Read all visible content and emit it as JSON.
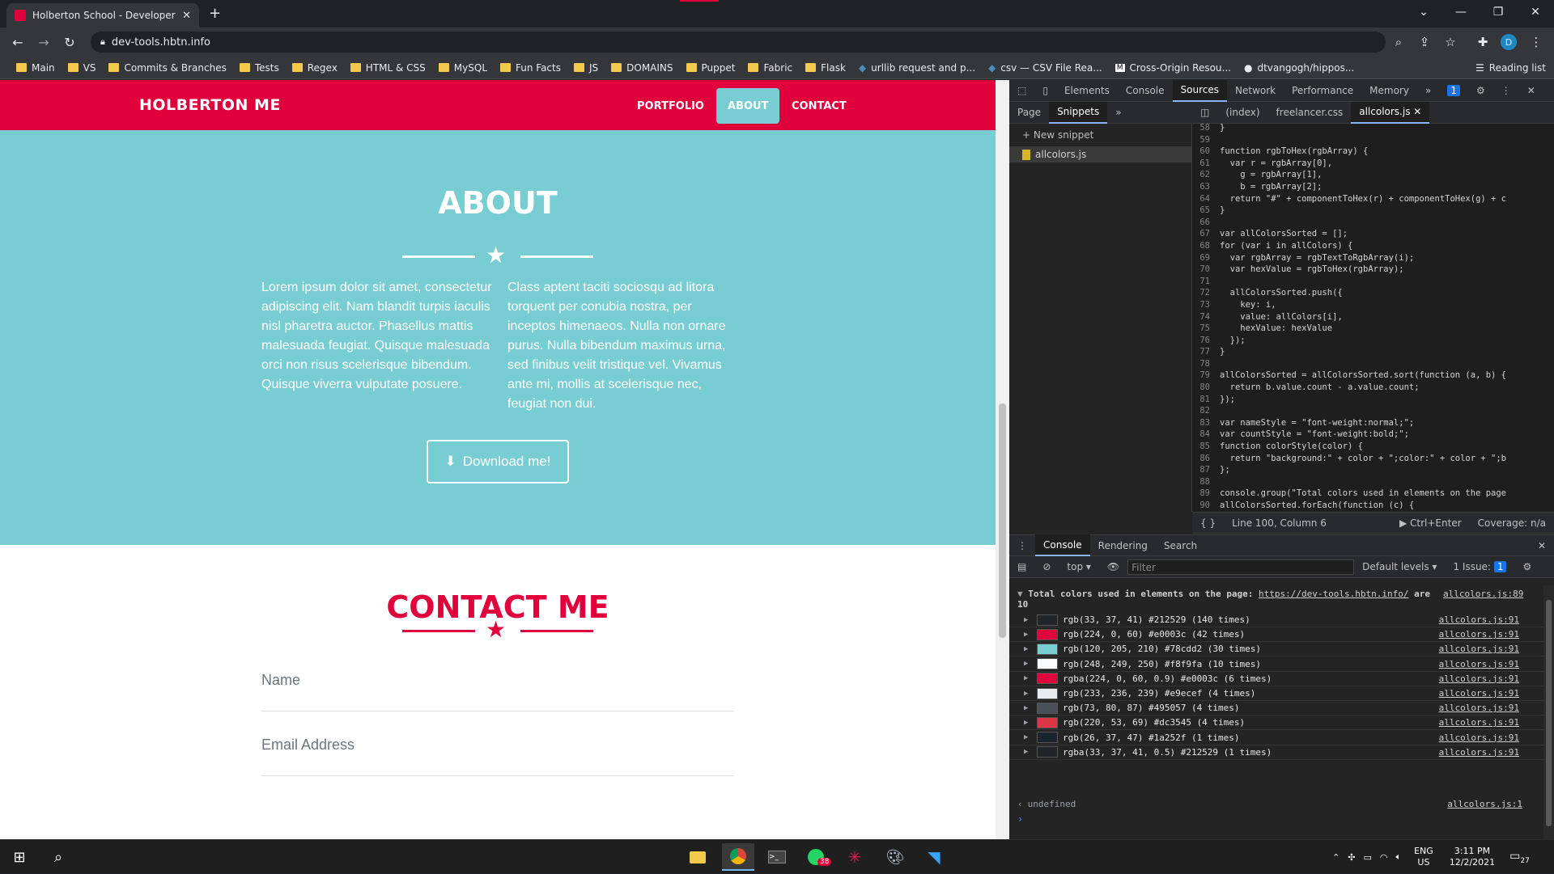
{
  "browser": {
    "tab_title": "Holberton School - Developer to",
    "url": "dev-tools.hbtn.info",
    "bookmarks": [
      "Main",
      "VS",
      "Commits & Branches",
      "Tests",
      "Regex",
      "HTML & CSS",
      "MySQL",
      "Fun Facts",
      "JS",
      "DOMAINS",
      "Puppet",
      "Fabric",
      "Flask",
      "urllib request and p...",
      "csv — CSV File Rea...",
      "Cross-Origin Resou...",
      "dtvangogh/hippos..."
    ],
    "reading_list": "Reading list",
    "profile_initial": "D"
  },
  "site": {
    "brand": "HOLBERTON ME",
    "nav": [
      "PORTFOLIO",
      "ABOUT",
      "CONTACT"
    ],
    "about_title": "ABOUT",
    "about_left": "Lorem ipsum dolor sit amet, consectetur adipiscing elit. Nam blandit turpis iaculis nisl pharetra auctor. Phasellus mattis malesuada feugiat. Quisque malesuada orci non risus scelerisque bibendum. Quisque viverra vulputate posuere.",
    "about_right": "Class aptent taciti sociosqu ad litora torquent per conubia nostra, per inceptos himenaeos. Nulla non ornare purus. Nulla bibendum maximus urna, sed finibus velit tristique vel. Vivamus ante mi, mollis at scelerisque nec, feugiat non dui.",
    "download_label": "Download me!",
    "contact_title": "CONTACT ME",
    "name_placeholder": "Name",
    "email_placeholder": "Email Address"
  },
  "devtools": {
    "tabs": [
      "Elements",
      "Console",
      "Sources",
      "Network",
      "Performance",
      "Memory"
    ],
    "issues_badge": "1",
    "nav_tabs": [
      "Page",
      "Snippets"
    ],
    "new_snippet": "+ New snippet",
    "snippet_file": "allcolors.js",
    "editor_tabs": [
      "(index)",
      "freelancer.css",
      "allcolors.js"
    ],
    "code": [
      {
        "n": "58",
        "t": "}"
      },
      {
        "n": "59",
        "t": ""
      },
      {
        "n": "60",
        "t": "function rgbToHex(rgbArray) {"
      },
      {
        "n": "61",
        "t": "  var r = rgbArray[0],"
      },
      {
        "n": "62",
        "t": "    g = rgbArray[1],"
      },
      {
        "n": "63",
        "t": "    b = rgbArray[2];"
      },
      {
        "n": "64",
        "t": "  return \"#\" + componentToHex(r) + componentToHex(g) + c"
      },
      {
        "n": "65",
        "t": "}"
      },
      {
        "n": "66",
        "t": ""
      },
      {
        "n": "67",
        "t": "var allColorsSorted = [];"
      },
      {
        "n": "68",
        "t": "for (var i in allColors) {"
      },
      {
        "n": "69",
        "t": "  var rgbArray = rgbTextToRgbArray(i);"
      },
      {
        "n": "70",
        "t": "  var hexValue = rgbToHex(rgbArray);"
      },
      {
        "n": "71",
        "t": ""
      },
      {
        "n": "72",
        "t": "  allColorsSorted.push({"
      },
      {
        "n": "73",
        "t": "    key: i,"
      },
      {
        "n": "74",
        "t": "    value: allColors[i],"
      },
      {
        "n": "75",
        "t": "    hexValue: hexValue"
      },
      {
        "n": "76",
        "t": "  });"
      },
      {
        "n": "77",
        "t": "}"
      },
      {
        "n": "78",
        "t": ""
      },
      {
        "n": "79",
        "t": "allColorsSorted = allColorsSorted.sort(function (a, b) {"
      },
      {
        "n": "80",
        "t": "  return b.value.count - a.value.count;"
      },
      {
        "n": "81",
        "t": "});"
      },
      {
        "n": "82",
        "t": ""
      },
      {
        "n": "83",
        "t": "var nameStyle = \"font-weight:normal;\";"
      },
      {
        "n": "84",
        "t": "var countStyle = \"font-weight:bold;\";"
      },
      {
        "n": "85",
        "t": "function colorStyle(color) {"
      },
      {
        "n": "86",
        "t": "  return \"background:\" + color + \";color:\" + color + \";b"
      },
      {
        "n": "87",
        "t": "};"
      },
      {
        "n": "88",
        "t": ""
      },
      {
        "n": "89",
        "t": "console.group(\"Total colors used in elements on the page"
      },
      {
        "n": "90",
        "t": "allColorsSorted.forEach(function (c) {"
      },
      {
        "n": "91",
        "t": ""
      }
    ],
    "status_line": "Line 100, Column 6",
    "run_hint": "Ctrl+Enter",
    "coverage": "Coverage: n/a",
    "drawer_tabs": [
      "Console",
      "Rendering",
      "Search"
    ],
    "context": "top",
    "filter_placeholder": "Filter",
    "levels": "Default levels",
    "issue_count": "1 Issue:",
    "group_header": "Total colors used in elements on the page:",
    "group_url": "https://dev-tools.hbtn.info/",
    "group_are": "are",
    "group_count": "10",
    "group_src": "allcolors.js:89",
    "colors": [
      {
        "label": "rgb(33, 37, 41) #212529 (140 times)",
        "hex": "#212529",
        "src": "allcolors.js:91"
      },
      {
        "label": "rgb(224, 0, 60) #e0003c (42 times)",
        "hex": "#e0003c",
        "src": "allcolors.js:91"
      },
      {
        "label": "rgb(120, 205, 210) #78cdd2 (30 times)",
        "hex": "#78cdd2",
        "src": "allcolors.js:91"
      },
      {
        "label": "rgb(248, 249, 250) #f8f9fa (10 times)",
        "hex": "#f8f9fa",
        "src": "allcolors.js:91"
      },
      {
        "label": "rgba(224, 0, 60, 0.9) #e0003c (6 times)",
        "hex": "#e0003c",
        "src": "allcolors.js:91"
      },
      {
        "label": "rgb(233, 236, 239) #e9ecef (4 times)",
        "hex": "#e9ecef",
        "src": "allcolors.js:91"
      },
      {
        "label": "rgb(73, 80, 87) #495057 (4 times)",
        "hex": "#495057",
        "src": "allcolors.js:91"
      },
      {
        "label": "rgb(220, 53, 69) #dc3545 (4 times)",
        "hex": "#dc3545",
        "src": "allcolors.js:91"
      },
      {
        "label": "rgb(26, 37, 47) #1a252f (1 times)",
        "hex": "#1a252f",
        "src": "allcolors.js:91"
      },
      {
        "label": "rgba(33, 37, 41, 0.5) #212529 (1 times)",
        "hex": "#212529",
        "src": "allcolors.js:91"
      }
    ],
    "result": "undefined",
    "result_src": "allcolors.js:1"
  },
  "taskbar": {
    "lang": "ENG",
    "region": "US",
    "time": "3:11 PM",
    "date": "12/2/2021",
    "whatsapp_badge": "38",
    "notif_count": "27"
  },
  "colors": {
    "brand_red": "#e0003c",
    "about_teal": "#78cdd2"
  }
}
